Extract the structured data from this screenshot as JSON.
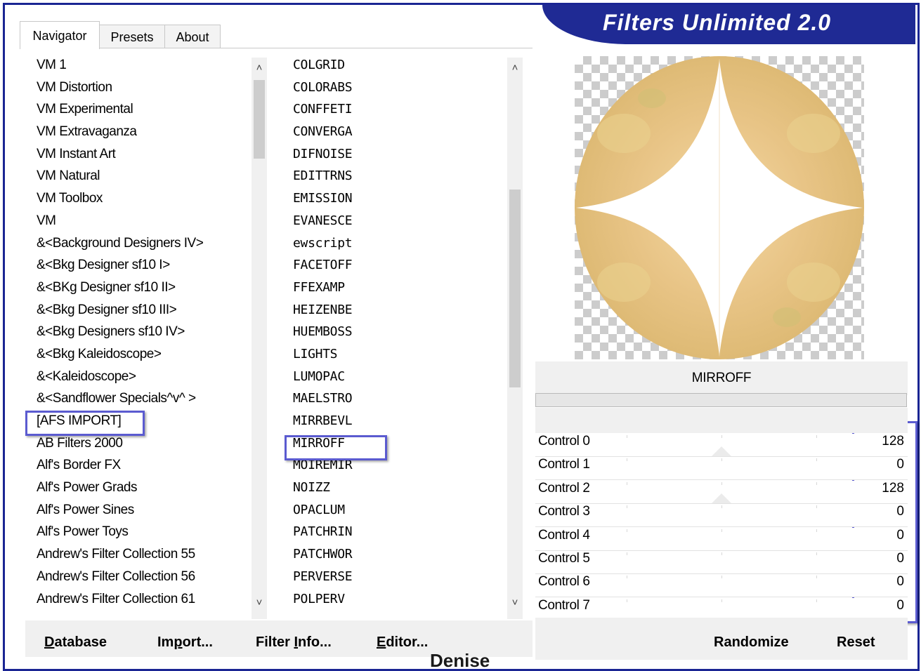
{
  "app_title": "Filters Unlimited 2.0",
  "tabs": [
    "Navigator",
    "Presets",
    "About"
  ],
  "left_list": [
    "VM 1",
    "VM Distortion",
    "VM Experimental",
    "VM Extravaganza",
    "VM Instant Art",
    "VM Natural",
    "VM Toolbox",
    "VM",
    "&<Background Designers IV>",
    "&<Bkg Designer sf10 I>",
    "&<BKg Designer sf10 II>",
    "&<Bkg Designer sf10 III>",
    "&<Bkg Designers sf10 IV>",
    "&<Bkg Kaleidoscope>",
    "&<Kaleidoscope>",
    "&<Sandflower Specials^v^ >",
    "[AFS IMPORT]",
    "AB Filters 2000",
    "Alf's Border FX",
    "Alf's Power Grads",
    "Alf's Power Sines",
    "Alf's Power Toys",
    "Andrew's Filter Collection 55",
    "Andrew's Filter Collection 56",
    "Andrew's Filter Collection 61"
  ],
  "left_selected": "[AFS IMPORT]",
  "mid_list": [
    "COLGRID",
    "COLORABS",
    "CONFFETI",
    "CONVERGA",
    "DIFNOISE",
    "EDITTRNS",
    "EMISSION",
    "EVANESCE",
    "ewscript",
    "FACETOFF",
    "FFEXAMP",
    "HEIZENBE",
    "HUEMBOSS",
    "LIGHTS",
    "LUMOPAC",
    "MAELSTRO",
    "MIRRBEVL",
    "MIRROFF",
    "MOIREMIR",
    "NOIZZ",
    "OPACLUM",
    "PATCHRIN",
    "PATCHWOR",
    "PERVERSE",
    "POLPERV"
  ],
  "mid_selected": "MIRROFF",
  "filter_name": "MIRROFF",
  "controls": [
    {
      "label": "Control 0",
      "value": "128"
    },
    {
      "label": "Control 1",
      "value": "0"
    },
    {
      "label": "Control 2",
      "value": "128"
    },
    {
      "label": "Control 3",
      "value": "0"
    },
    {
      "label": "Control 4",
      "value": "0"
    },
    {
      "label": "Control 5",
      "value": "0"
    },
    {
      "label": "Control 6",
      "value": "0"
    },
    {
      "label": "Control 7",
      "value": "0"
    }
  ],
  "buttons": {
    "database_u": "D",
    "database_rest": "atabase",
    "import_pre": "Im",
    "import_u": "p",
    "import_rest": "ort...",
    "filterinfo_pre": "Filter ",
    "filterinfo_u": "I",
    "filterinfo_rest": "nfo...",
    "editor_u": "E",
    "editor_rest": "ditor...",
    "randomize": "Randomize",
    "reset": "Reset"
  },
  "watermark": "Denise",
  "colors": {
    "accent": "#1f2a94",
    "highlight": "#5b5bd0"
  }
}
